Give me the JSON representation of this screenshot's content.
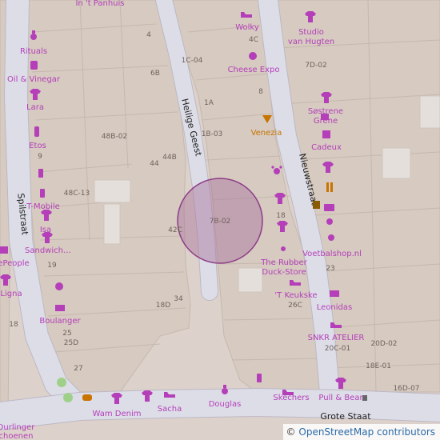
{
  "map": {
    "streets": {
      "heilige_geest": "Heilige Geest",
      "nieuwstraat": "Nieuwstraat",
      "spilstraat": "Spilstraat",
      "grote_staat": "Grote Staat"
    },
    "pois": {
      "in_t_panhuis": "In 't Panhuis",
      "rituals": "Rituals",
      "oil_vinegar": "Oil & Vinegar",
      "lara": "Lara",
      "etos": "Etos",
      "t_mobile": "T-Mobile",
      "isa": "Isa",
      "sandwich": "Sandwich…",
      "peoplepeople": "ePeople",
      "ligna": "Ligna",
      "boulanger": "Boulanger",
      "wam_denim": "Wam Denim",
      "sacha": "Sacha",
      "douglas": "Douglas",
      "skechers": "Skechers",
      "pull_bear": "Pull & Bear",
      "wolky": "Wolky",
      "cheese_expo": "Cheese Expo",
      "venezia": "Venezia",
      "studio_van_hugten_1": "Studio",
      "studio_van_hugten_2": "van Hugten",
      "sostrene_grene_1": "Søstrene",
      "sostrene_grene_2": "Grene",
      "cadeux": "Cadeux",
      "voetbalshop": "Voetbalshop.nl",
      "rubber_duck_1": "The Rubber",
      "rubber_duck_2": "Duck-Store",
      "t_keukske": "'T Keukske",
      "leonidas": "Leonidas",
      "snkr_atelier": "SNKR ATELIER",
      "durlinger_1": "Durlinger",
      "durlinger_2": "choenen"
    },
    "addresses": {
      "a4": "4",
      "a4c": "4C",
      "a1c04": "1C-04",
      "a6b": "6B",
      "a1a": "1A",
      "a8": "8",
      "a7d02": "7D-02",
      "a1b03": "1B-03",
      "a48b02": "48B-02",
      "a44b": "44B",
      "a44": "44",
      "a9": "9",
      "a48c13": "48C-13",
      "a7b02": "7B-02",
      "a18a": "18",
      "a42c": "42C",
      "a19": "19",
      "a23": "23",
      "a34": "34",
      "a18d": "18D",
      "a26c": "26C",
      "a18b": "18",
      "a25": "25",
      "a25d": "25D",
      "a20c01": "20C-01",
      "a20d02": "20D-02",
      "a27": "27",
      "a18e01": "18E-01",
      "a16d07": "16D-07"
    },
    "attribution": {
      "copyright": "©",
      "link_text": "OpenStreetMap contributors"
    },
    "colors": {
      "background": "#dcd1cb",
      "building": "#d4c8bf",
      "building_stroke": "#c3b5ab",
      "road": "#ffffff",
      "road_edge": "#bfb7b2",
      "pedestrian": "#dddde8",
      "poi_purple": "#b43fb8",
      "poi_orange": "#c77400",
      "highlight_circle": "#a8709c"
    }
  }
}
